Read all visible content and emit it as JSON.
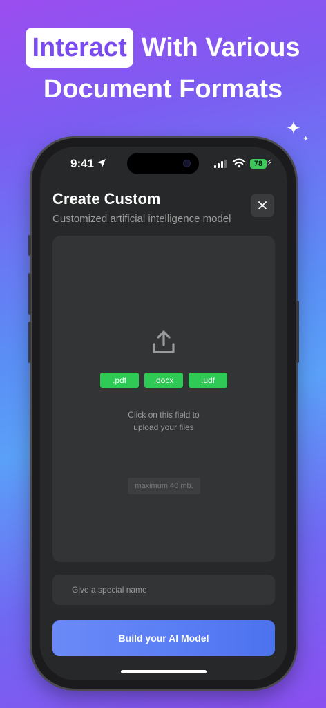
{
  "promo": {
    "headline_highlight": "Interact",
    "headline_rest": "With Various",
    "headline_line2": "Document Formats"
  },
  "status_bar": {
    "time": "9:41",
    "battery": "78"
  },
  "sheet": {
    "title": "Create Custom",
    "subtitle": "Customized artificial intelligence model",
    "close_icon": "close-icon"
  },
  "upload": {
    "icon": "upload-icon",
    "formats": [
      ".pdf",
      ".docx",
      ".udf"
    ],
    "hint_line1": "Click on this field to",
    "hint_line2": "upload your files",
    "max_size": "maximum 40 mb."
  },
  "name_field": {
    "placeholder": "Give a special name",
    "value": ""
  },
  "build_button": {
    "label": "Build your AI Model"
  },
  "colors": {
    "format_tag": "#2fc955",
    "button_gradient_start": "#6b8af7",
    "button_gradient_end": "#4c72ee",
    "screen_bg": "#272829"
  }
}
